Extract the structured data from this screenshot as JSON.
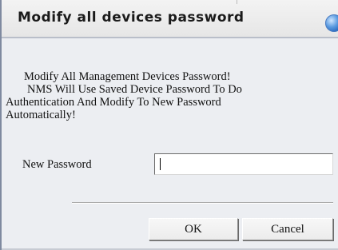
{
  "dialog": {
    "title": "Modify all devices password",
    "title_icon": "globe-icon",
    "message_lines": [
      "Modify All Management Devices Password!",
      "NMS Will Use Saved Device Password  To Do",
      "Authentication And Modify To New Password",
      "Automatically!"
    ],
    "new_password_label": "New Password",
    "new_password_value": "",
    "ok_label": "OK",
    "cancel_label": "Cancel"
  }
}
